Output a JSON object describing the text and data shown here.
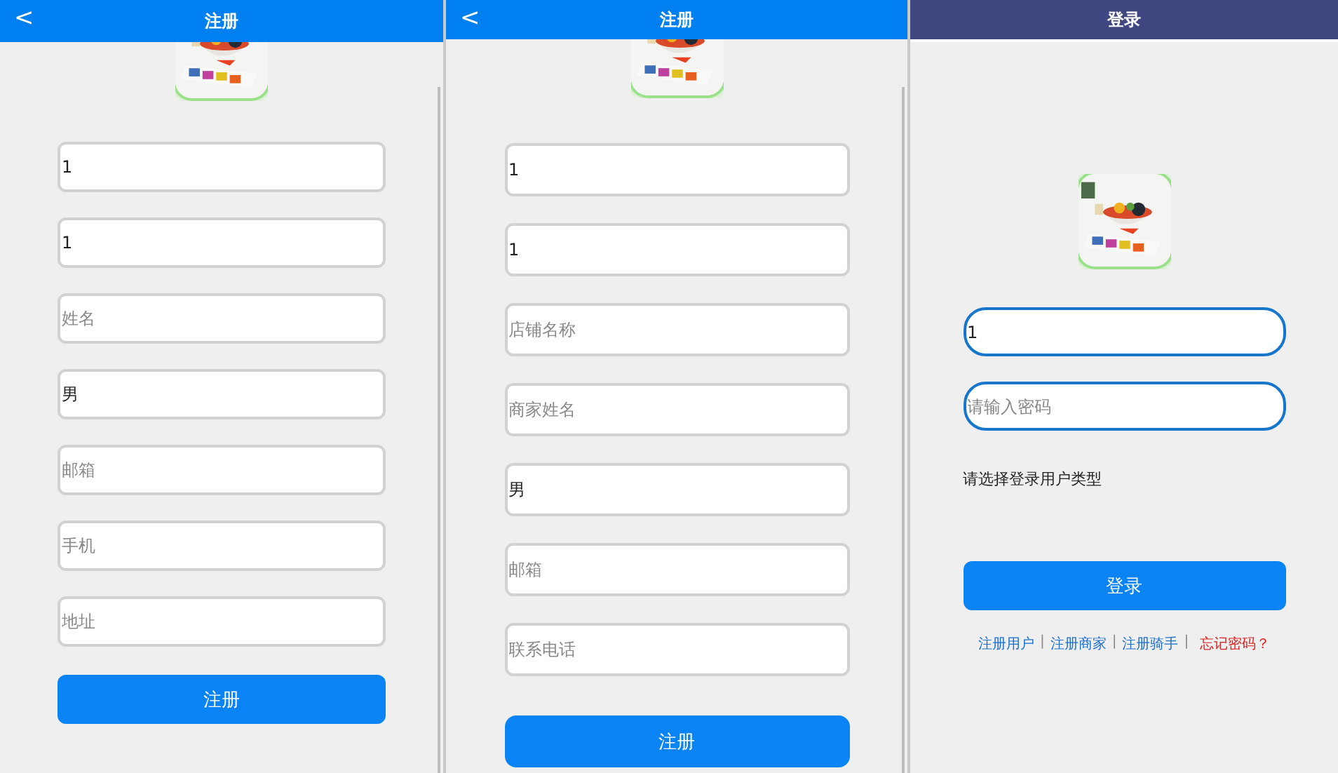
{
  "screens": [
    {
      "kind": "register",
      "header": {
        "title": "注册",
        "back": "<"
      },
      "fields": [
        {
          "value": "1"
        },
        {
          "value": "1"
        },
        {
          "placeholder": "姓名"
        },
        {
          "value": "男"
        },
        {
          "placeholder": "邮箱"
        },
        {
          "placeholder": "手机"
        },
        {
          "placeholder": "地址"
        }
      ],
      "button": "注册"
    },
    {
      "kind": "register",
      "header": {
        "title": "注册",
        "back": "<"
      },
      "fields": [
        {
          "value": "1"
        },
        {
          "value": "1"
        },
        {
          "placeholder": "店铺名称"
        },
        {
          "placeholder": "商家姓名"
        },
        {
          "value": "男"
        },
        {
          "placeholder": "邮箱"
        },
        {
          "placeholder": "联系电话"
        }
      ],
      "button": "注册"
    },
    {
      "kind": "login",
      "header": {
        "title": "登录"
      },
      "fields": [
        {
          "value": "1"
        },
        {
          "placeholder": "请输入密码"
        }
      ],
      "prompt": "请选择登录用户类型",
      "button": "登录",
      "links": [
        {
          "kind": "link",
          "text": "注册用户"
        },
        {
          "kind": "separator",
          "text": "|"
        },
        {
          "kind": "link",
          "text": "注册商家"
        },
        {
          "kind": "separator",
          "text": "|"
        },
        {
          "kind": "link",
          "text": "注册骑手"
        },
        {
          "kind": "separator",
          "text": "|"
        },
        {
          "kind": "alert-link",
          "text": "忘记密码？"
        }
      ]
    }
  ]
}
